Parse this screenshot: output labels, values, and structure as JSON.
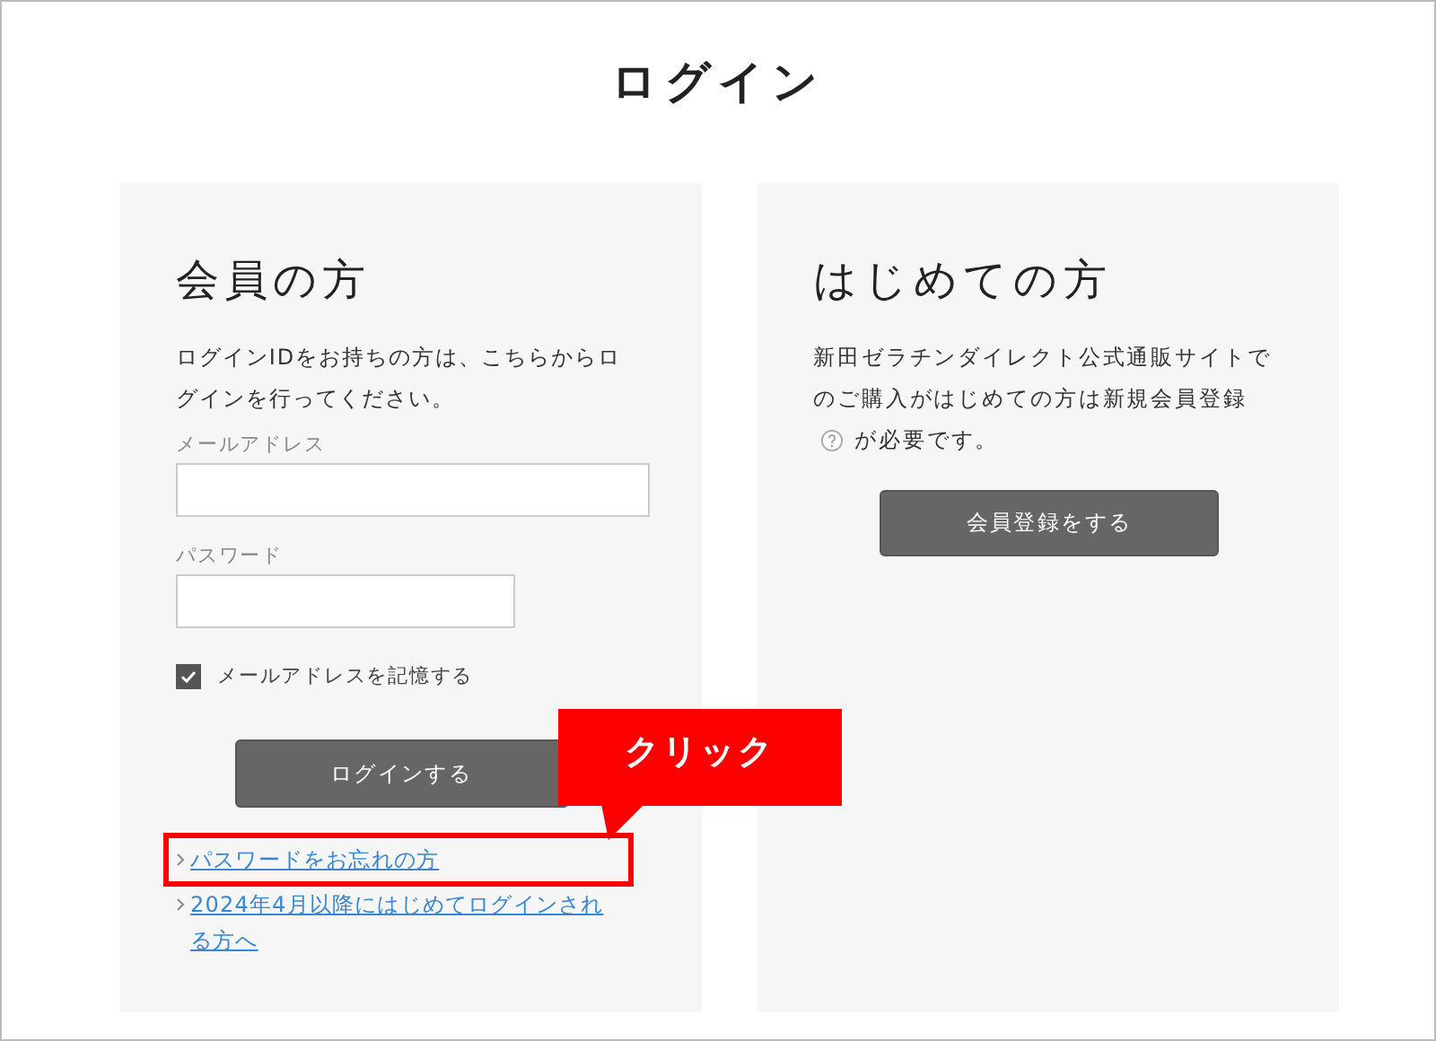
{
  "page_title": "ログイン",
  "member": {
    "heading": "会員の方",
    "description": "ログインIDをお持ちの方は、こちらからログインを行ってください。",
    "fields": [
      {
        "label": "メールアドレス",
        "kind": "wide"
      },
      {
        "label": "パスワード",
        "kind": "narrow"
      }
    ],
    "remember": {
      "label": "メールアドレスを記憶する",
      "checked": true
    },
    "button": "ログインする",
    "links": [
      {
        "label": "パスワードをお忘れの方",
        "highlighted": true
      },
      {
        "label": "2024年4月以降にはじめてログインされる方へ",
        "highlighted": false
      }
    ]
  },
  "newcomer": {
    "heading": "はじめての方",
    "text_before": "新田ゼラチンダイレクト公式通販サイトでのご購入がはじめての方は新規会員登録",
    "text_after": "が必要です。",
    "button": "会員登録をする"
  },
  "annotation": {
    "callout": "クリック"
  }
}
